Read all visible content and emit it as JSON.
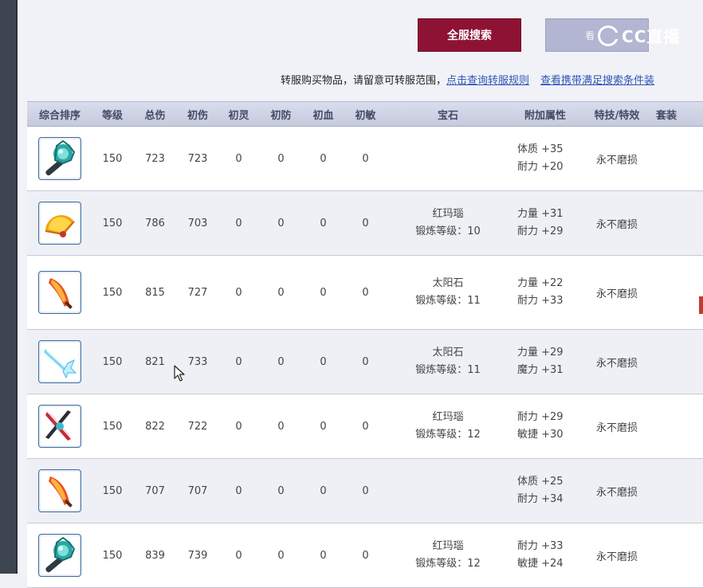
{
  "toolbar": {
    "search_all_label": "全服搜索"
  },
  "watermark": {
    "small": "看",
    "brand": "CC直播"
  },
  "notice": {
    "text": "转服购买物品，请留意可转服范围，",
    "link_rules": "点击查询转服规则",
    "link_carry": "查看携带满足搜索条件装"
  },
  "table": {
    "headers": [
      "综合排序",
      "等级",
      "总伤",
      "初伤",
      "初灵",
      "初防",
      "初血",
      "初敏",
      "宝石",
      "附加属性",
      "特技/特效",
      "套装"
    ],
    "rows": [
      {
        "icon": "teal-mace-icon",
        "level": "150",
        "total": "723",
        "base": "723",
        "spirit": "0",
        "defense": "0",
        "hp": "0",
        "agility": "0",
        "gem": "",
        "forge": "",
        "attr1": "体质 +35",
        "attr2": "耐力 +20",
        "skill": "永不磨损"
      },
      {
        "icon": "golden-fan-icon",
        "level": "150",
        "total": "786",
        "base": "703",
        "spirit": "0",
        "defense": "0",
        "hp": "0",
        "agility": "0",
        "gem": "红玛瑙",
        "forge": "锻炼等级：10",
        "attr1": "力量 +31",
        "attr2": "耐力 +29",
        "skill": "永不磨损"
      },
      {
        "icon": "flame-blade-icon",
        "level": "150",
        "total": "815",
        "base": "727",
        "spirit": "0",
        "defense": "0",
        "hp": "0",
        "agility": "0",
        "gem": "太阳石",
        "forge": "锻炼等级：11",
        "attr1": "力量 +22",
        "attr2": "耐力 +33",
        "skill": "永不磨损"
      },
      {
        "icon": "ice-sword-icon",
        "level": "150",
        "total": "821",
        "base": "733",
        "spirit": "0",
        "defense": "0",
        "hp": "0",
        "agility": "0",
        "gem": "太阳石",
        "forge": "锻炼等级：11",
        "attr1": "力量 +29",
        "attr2": "魔力 +31",
        "skill": "永不磨损"
      },
      {
        "icon": "crossed-blades-icon",
        "level": "150",
        "total": "822",
        "base": "722",
        "spirit": "0",
        "defense": "0",
        "hp": "0",
        "agility": "0",
        "gem": "红玛瑙",
        "forge": "锻炼等级：12",
        "attr1": "耐力 +29",
        "attr2": "敏捷 +30",
        "skill": "永不磨损"
      },
      {
        "icon": "flame-blade-icon",
        "level": "150",
        "total": "707",
        "base": "707",
        "spirit": "0",
        "defense": "0",
        "hp": "0",
        "agility": "0",
        "gem": "",
        "forge": "",
        "attr1": "体质 +25",
        "attr2": "耐力 +34",
        "skill": "永不磨损"
      },
      {
        "icon": "teal-mace-icon",
        "level": "150",
        "total": "839",
        "base": "739",
        "spirit": "0",
        "defense": "0",
        "hp": "0",
        "agility": "0",
        "gem": "红玛瑙",
        "forge": "锻炼等级：12",
        "attr1": "耐力 +33",
        "attr2": "敏捷 +24",
        "skill": "永不磨损"
      }
    ]
  },
  "colors": {
    "accent_button": "#8d1234",
    "link": "#2f55b8",
    "header_bg": "#c9cee0"
  }
}
